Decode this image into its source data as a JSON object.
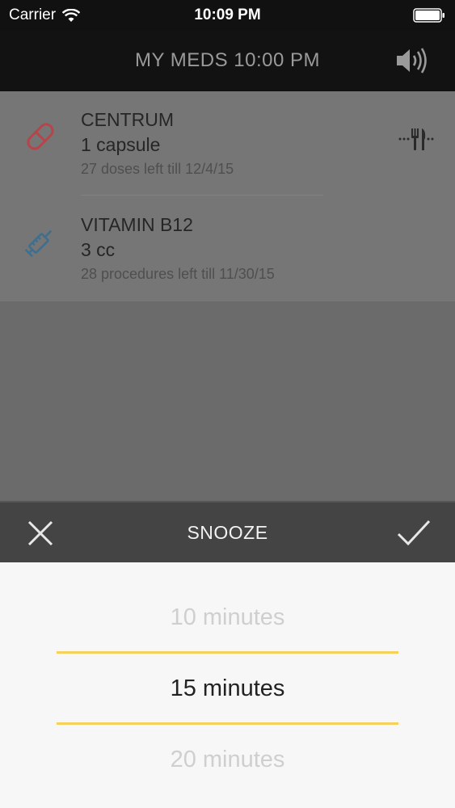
{
  "status_bar": {
    "carrier": "Carrier",
    "time": "10:09 PM"
  },
  "nav": {
    "title": "MY MEDS 10:00 PM",
    "sound_icon": "speaker-icon"
  },
  "meds": [
    {
      "name": "CENTRUM",
      "dose": "1 capsule",
      "remaining": "27 doses left till 12/4/15",
      "icon": "pill-icon",
      "icon_color": "#b5454b",
      "with_food": true
    },
    {
      "name": "VITAMIN B12",
      "dose": "3 cc",
      "remaining": "28 procedures left till 11/30/15",
      "icon": "syringe-icon",
      "icon_color": "#3f6f8e",
      "with_food": false
    }
  ],
  "snooze": {
    "title": "SNOOZE",
    "cancel_icon": "close-icon",
    "confirm_icon": "checkmark-icon"
  },
  "picker": {
    "options": [
      "10 minutes",
      "15 minutes",
      "20 minutes"
    ],
    "selected": "15 minutes",
    "accent": "#f5d15c"
  }
}
